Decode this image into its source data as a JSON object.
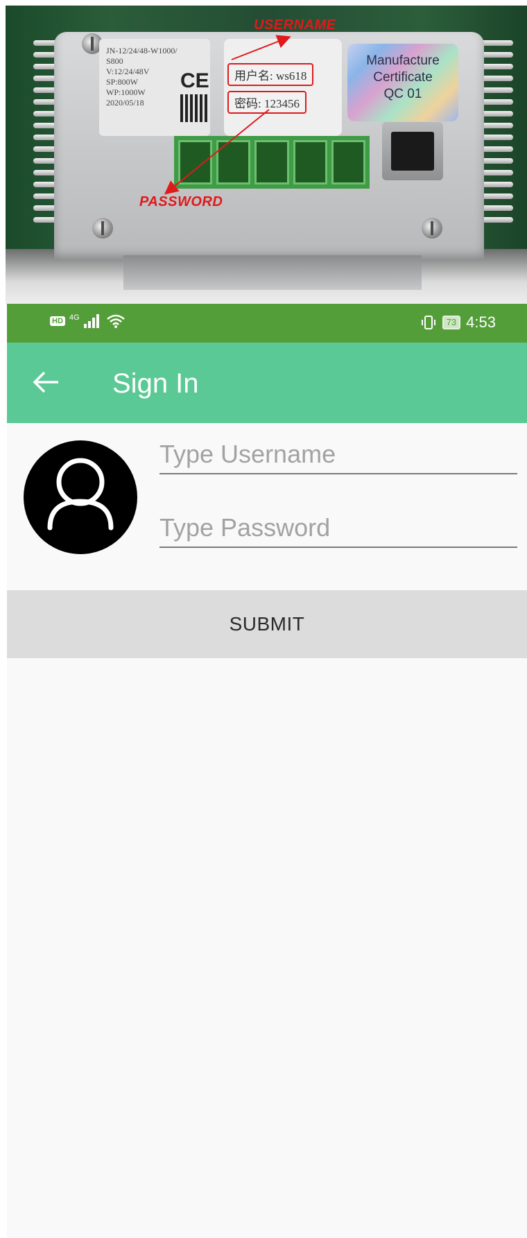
{
  "photo": {
    "label_specs": [
      "JN-12/24/48-W1000/",
      "S800",
      "V:12/24/48V",
      "SP:800W",
      "WP:1000W",
      "2020/05/18"
    ],
    "ce_mark": "CE",
    "username_box": "用户名: ws618",
    "password_box": "密码: 123456",
    "certificate": [
      "Manufacture",
      "Certificate",
      "QC 01"
    ],
    "annotation_username": "USERNAME",
    "annotation_password": "PASSWORD",
    "annotation_color": "#e0191b"
  },
  "status_bar": {
    "network": "4G",
    "hd_badge": "HD",
    "battery": "73",
    "time": "4:53",
    "color": "#549e3a"
  },
  "app_bar": {
    "title": "Sign In",
    "back_icon": "arrow-left-icon",
    "color": "#5bc995"
  },
  "form": {
    "username_placeholder": "Type Username",
    "username_value": "",
    "password_placeholder": "Type Password",
    "password_value": "",
    "submit_label": "SUBMIT",
    "avatar_icon": "user-avatar-icon"
  }
}
